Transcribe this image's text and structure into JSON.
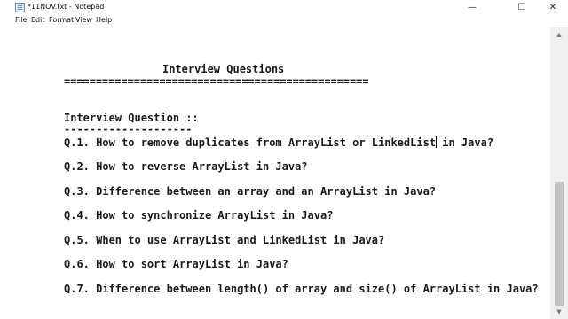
{
  "window": {
    "title": "*11NOV.txt - Notepad",
    "minimize_glyph": "—",
    "maximize_glyph": "☐",
    "close_glyph": "✕"
  },
  "menu": [
    "File",
    "Edit",
    "Format",
    "View",
    "Help"
  ],
  "editor": {
    "title_line": "Interview Questions",
    "title_underline": "================================================",
    "section_heading": "Interview Question ::",
    "section_underline": "--------------------",
    "q1_before_caret": "Q.1. How to remove duplicates from ArrayList or LinkedList",
    "q1_after_caret": " in Java?",
    "questions": [
      "Q.2. How to reverse ArrayList in Java?",
      "Q.3. Difference between an array and an ArrayList in Java?",
      "Q.4. How to synchronize ArrayList in Java?",
      "Q.5. When to use ArrayList and LinkedList in Java?",
      "Q.6. How to sort ArrayList in Java?",
      "Q.7. Difference between length() of array and size() of ArrayList in Java?"
    ]
  },
  "scrollbar": {
    "up_glyph": "▲",
    "down_glyph": "▼"
  }
}
